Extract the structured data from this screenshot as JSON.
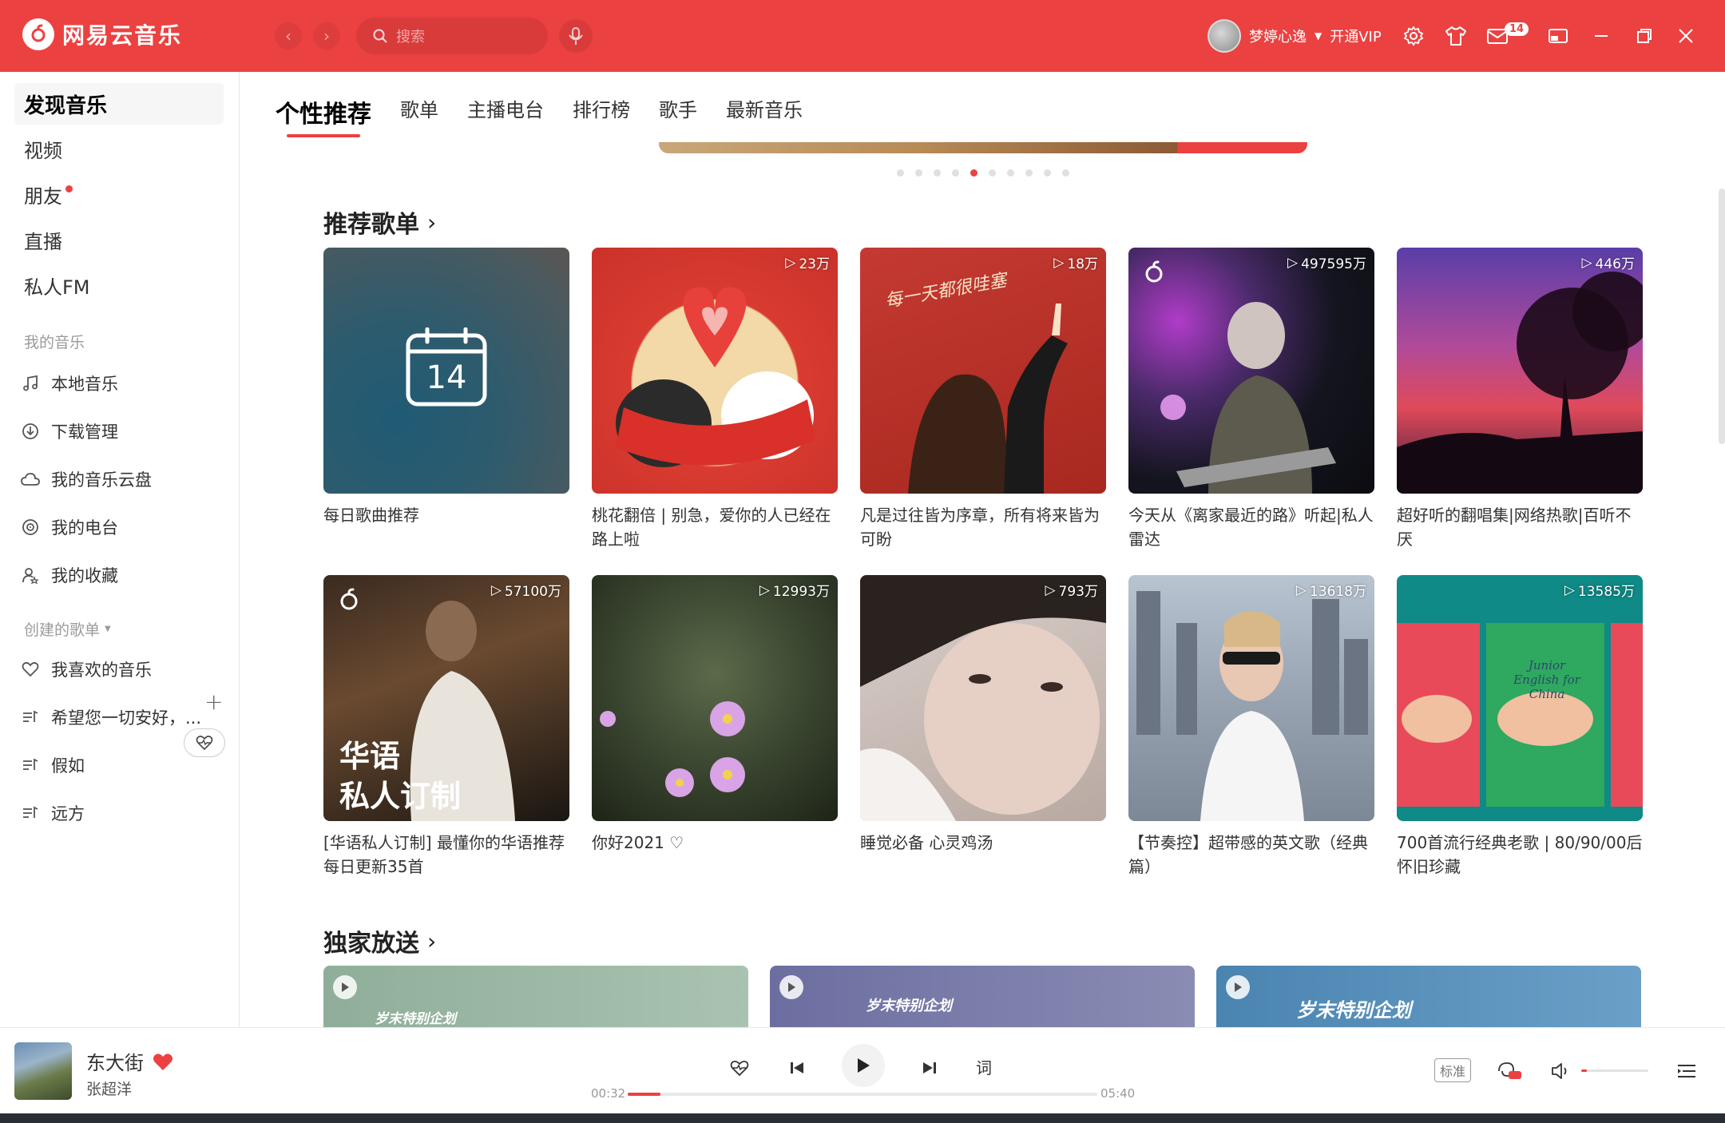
{
  "app": {
    "name": "网易云音乐"
  },
  "header": {
    "search_placeholder": "搜索",
    "username": "梦婷心逸",
    "vip": "开通VIP",
    "mail_count": "14"
  },
  "sidebar": {
    "main": [
      {
        "label": "发现音乐",
        "active": true
      },
      {
        "label": "视频"
      },
      {
        "label": "朋友",
        "dot": true
      },
      {
        "label": "直播"
      },
      {
        "label": "私人FM"
      }
    ],
    "my_music_title": "我的音乐",
    "my_music": [
      {
        "label": "本地音乐",
        "icon": "music-note-icon"
      },
      {
        "label": "下载管理",
        "icon": "download-icon"
      },
      {
        "label": "我的音乐云盘",
        "icon": "cloud-icon"
      },
      {
        "label": "我的电台",
        "icon": "radio-icon"
      },
      {
        "label": "我的收藏",
        "icon": "collection-icon"
      }
    ],
    "created_title": "创建的歌单",
    "created": [
      {
        "label": "我喜欢的音乐",
        "icon": "heart-icon"
      },
      {
        "label": "希望您一切安好，...",
        "icon": "playlist-icon"
      },
      {
        "label": "假如",
        "icon": "playlist-icon"
      },
      {
        "label": "远方",
        "icon": "playlist-icon"
      }
    ]
  },
  "tabs": [
    "个性推荐",
    "歌单",
    "主播电台",
    "排行榜",
    "歌手",
    "最新音乐"
  ],
  "banner": {
    "dots": 10,
    "active_dot": 4
  },
  "recommended": {
    "title": "推荐歌单",
    "cards": [
      {
        "title": "每日歌曲推荐",
        "count": "",
        "calendar_day": "14"
      },
      {
        "title": "桃花翻倍 | 别急，爱你的人已经在路上啦",
        "count": "23万"
      },
      {
        "title": "凡是过往皆为序章，所有将来皆为可盼",
        "count": "18万",
        "cover_text": "每一天都很哇塞"
      },
      {
        "title": "今天从《离家最近的路》听起|私人雷达",
        "count": "497595万"
      },
      {
        "title": "超好听的翻唱集|网络热歌|百听不厌",
        "count": "446万"
      },
      {
        "title": "[华语私人订制] 最懂你的华语推荐 每日更新35首",
        "count": "57100万",
        "cover_text_1": "华语",
        "cover_text_2": "私人订制"
      },
      {
        "title": "你好2021",
        "count": "12993万"
      },
      {
        "title": "睡觉必备 心灵鸡汤",
        "count": "793万"
      },
      {
        "title": "【节奏控】超带感的英文歌（经典篇）",
        "count": "13618万"
      },
      {
        "title": "700首流行经典老歌 | 80/90/00后怀旧珍藏",
        "count": "13585万",
        "cover_text": "Junior English for China"
      }
    ]
  },
  "exclusive": {
    "title": "独家放送",
    "items": [
      {
        "label": "岁末特别企划"
      },
      {
        "label": "岁末特别企划"
      },
      {
        "label": "岁末特别企划"
      }
    ]
  },
  "player": {
    "song": "东大街",
    "artist": "张超洋",
    "current_time": "00:32",
    "total_time": "05:40",
    "progress": 0.07,
    "lyric_label": "词",
    "quality": "标准",
    "volume": 0.08
  },
  "colors": {
    "accent": "#ec4141"
  }
}
